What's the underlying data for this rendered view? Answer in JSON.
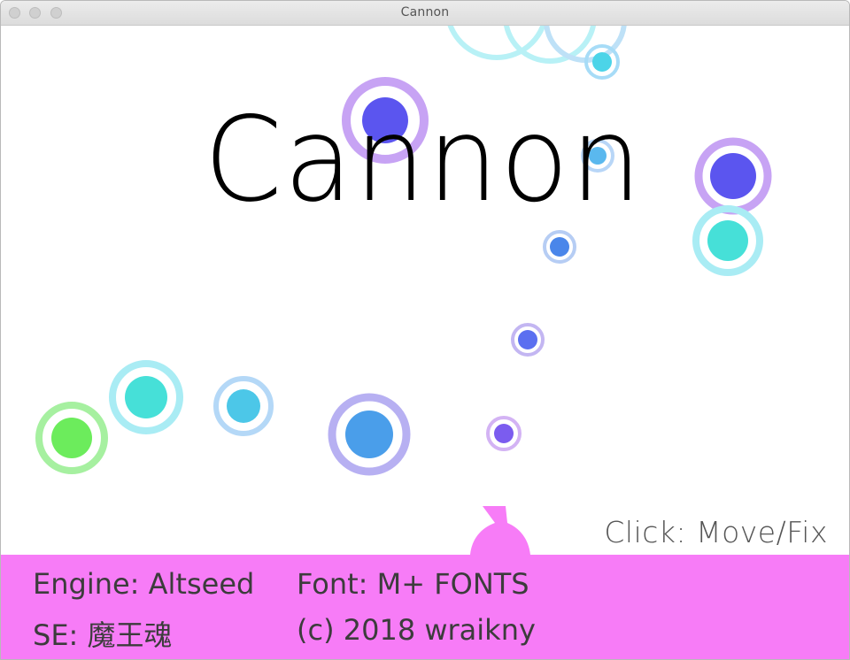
{
  "window": {
    "title": "Cannon"
  },
  "game": {
    "title": "Cannon",
    "hint": "Click: Move/Fix"
  },
  "footer": {
    "engine": "Engine: Altseed",
    "font": "Font: M+ FONTS",
    "se": "SE: 魔王魂",
    "copyright": "(c) 2018 wraikny"
  },
  "colors": {
    "footer_bg": "#f77cf7",
    "cannon": "#f77cf7",
    "indigo": "#5b55ef",
    "violet": "#b58cf2",
    "cyan": "#4cd9e8",
    "teal": "#42e0d8",
    "blue": "#4aa0ea",
    "green": "#6cec5c"
  }
}
